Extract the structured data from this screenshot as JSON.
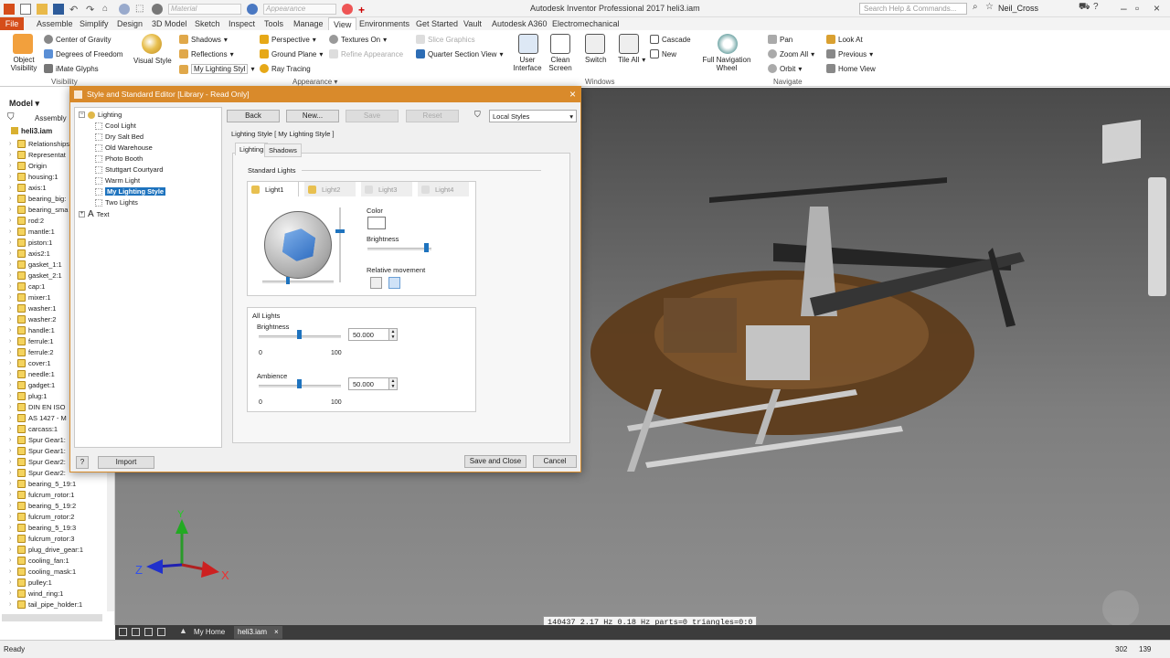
{
  "window": {
    "title": "Autodesk Inventor Professional 2017   heli3.iam",
    "search_placeholder": "Search Help & Commands...",
    "user": "Neil_Cross"
  },
  "quick_access": {
    "material": "Material",
    "appearance": "Appearance"
  },
  "menu": [
    "File",
    "Assemble",
    "Simplify",
    "Design",
    "3D Model",
    "Sketch",
    "Inspect",
    "Tools",
    "Manage",
    "View",
    "Environments",
    "Get Started",
    "Vault",
    "Autodesk A360",
    "Electromechanical"
  ],
  "ribbon": {
    "visibility": {
      "object_visibility": "Object Visibility",
      "center_gravity": "Center of Gravity",
      "dof": "Degrees of Freedom",
      "imate": "iMate Glyphs",
      "label": "Visibility"
    },
    "appearance": {
      "visual_style": "Visual Style",
      "shadows": "Shadows",
      "reflections": "Reflections",
      "lighting_style": "My Lighting Styl",
      "perspective": "Perspective",
      "ground_plane": "Ground Plane",
      "ray_tracing": "Ray Tracing",
      "textures_on": "Textures On",
      "refine_appearance": "Refine Appearance",
      "slice_graphics": "Slice Graphics",
      "quarter_section": "Quarter Section View",
      "label": "Appearance"
    },
    "windows": {
      "user_interface": "User Interface",
      "clean_screen": "Clean Screen",
      "switch": "Switch",
      "tile_all": "Tile All",
      "cascade": "Cascade",
      "new": "New",
      "label": "Windows"
    },
    "navigate": {
      "full_nav": "Full Navigation Wheel",
      "pan": "Pan",
      "zoom_all": "Zoom All",
      "orbit": "Orbit",
      "look_at": "Look At",
      "previous": "Previous",
      "home_view": "Home View",
      "label": "Navigate"
    }
  },
  "model_panel": {
    "title": "Model",
    "filter": "Assembly",
    "root": "heli3.iam",
    "items": [
      "Relationships",
      "Representat",
      "Origin",
      "housing:1",
      "axis:1",
      "bearing_big:",
      "bearing_sma",
      "rod:2",
      "mantle:1",
      "piston:1",
      "axis2:1",
      "gasket_1:1",
      "gasket_2:1",
      "cap:1",
      "mixer:1",
      "washer:1",
      "washer:2",
      "handle:1",
      "ferrule:1",
      "ferrule:2",
      "cover:1",
      "needle:1",
      "gadget:1",
      "plug:1",
      "DIN EN ISO",
      "AS 1427 - M",
      "carcass:1",
      "Spur Gear1:",
      "Spur Gear1:",
      "Spur Gear2:",
      "Spur Gear2:",
      "bearing_5_19:1",
      "fulcrum_rotor:1",
      "bearing_5_19:2",
      "fulcrum_rotor:2",
      "bearing_5_19:3",
      "fulcrum_rotor:3",
      "plug_drive_gear:1",
      "cooling_fan:1",
      "cooling_mask:1",
      "pulley:1",
      "wind_ring:1",
      "tail_pipe_holder:1"
    ]
  },
  "dialog": {
    "title": "Style and Standard Editor [Library - Read Only]",
    "buttons": {
      "back": "Back",
      "new": "New...",
      "save": "Save",
      "reset": "Reset",
      "import": "Import",
      "save_close": "Save and Close",
      "cancel": "Cancel"
    },
    "filter": "Local Styles",
    "tree": {
      "lighting": "Lighting",
      "styles": [
        "Cool Light",
        "Dry Salt Bed",
        "Old Warehouse",
        "Photo Booth",
        "Stuttgart Courtyard",
        "Warm Light",
        "My Lighting Style",
        "Two Lights"
      ],
      "text": "Text"
    },
    "heading": "Lighting Style [ My Lighting Style ]",
    "tabs": [
      "Lighting",
      "Shadows"
    ],
    "standard_lights": "Standard Lights",
    "light_tabs": [
      "Light1",
      "Light2",
      "Light3",
      "Light4"
    ],
    "color_label": "Color",
    "brightness_label": "Brightness",
    "relative_movement": "Relative movement",
    "all_lights": {
      "title": "All Lights",
      "brightness": "Brightness",
      "brightness_value": "50.000",
      "ambience": "Ambience",
      "ambience_value": "50.000",
      "min": "0",
      "max": "100"
    }
  },
  "viewport": {
    "coord_text": "140437   2.17 Hz   0.18 Hz  parts=0 triangles=0:0"
  },
  "doc_tabs": {
    "home": "My Home",
    "file": "heli3.iam"
  },
  "status": {
    "text": "Ready",
    "n1": "302",
    "n2": "139"
  },
  "colors": {
    "accent": "#d54d1a",
    "dialog_title": "#d98a2b",
    "select": "#1e73be"
  }
}
